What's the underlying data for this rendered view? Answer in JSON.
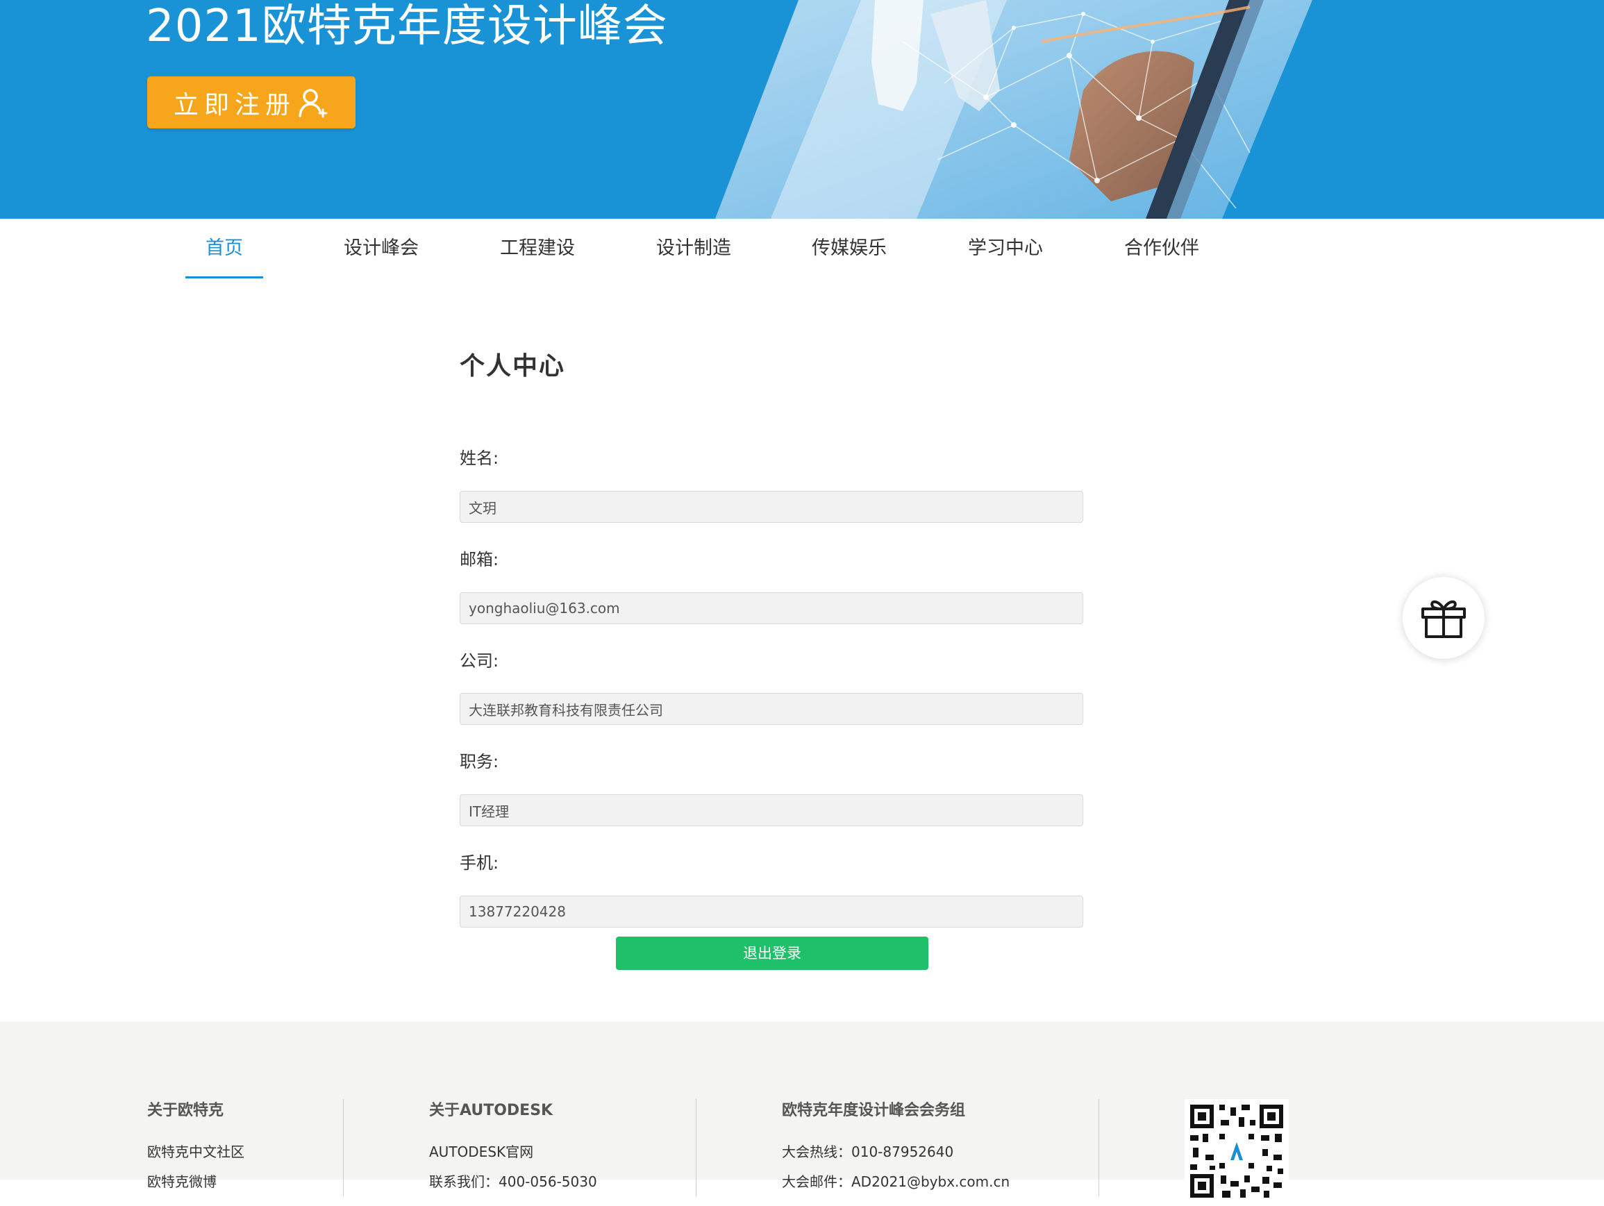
{
  "colors": {
    "brand_blue": "#1a93d6",
    "nav_active": "#1a8fd6",
    "register_orange": "#f7a51b",
    "logout_green": "#1ec16a",
    "footer_bg": "#f4f4f2"
  },
  "hero": {
    "title": "2021欧特克年度设计峰会",
    "register_label": "立即注册",
    "register_icon": "add-user-icon"
  },
  "nav": {
    "items": [
      {
        "label": "首页",
        "active": true
      },
      {
        "label": "设计峰会",
        "active": false
      },
      {
        "label": "工程建设",
        "active": false
      },
      {
        "label": "设计制造",
        "active": false
      },
      {
        "label": "传媒娱乐",
        "active": false
      },
      {
        "label": "学习中心",
        "active": false
      },
      {
        "label": "合作伙伴",
        "active": false
      }
    ]
  },
  "profile": {
    "title": "个人中心",
    "fields": [
      {
        "label": "姓名:",
        "value": "文玥"
      },
      {
        "label": "邮箱:",
        "value": "yonghaoliu@163.com"
      },
      {
        "label": "公司:",
        "value": "大连联邦教育科技有限责任公司"
      },
      {
        "label": "职务:",
        "value": "IT经理"
      },
      {
        "label": "手机:",
        "value": "13877220428"
      }
    ],
    "logout_label": "退出登录"
  },
  "gift": {
    "icon": "gift-icon"
  },
  "footer": {
    "col1": {
      "heading": "关于欧特克",
      "links": [
        "欧特克中文社区",
        "欧特克微博"
      ]
    },
    "col2": {
      "heading": "关于AUTODESK",
      "links": [
        "AUTODESK官网",
        "联系我们：400-056-5030"
      ]
    },
    "col3": {
      "heading": "欧特克年度设计峰会会务组",
      "hotline": "大会热线：010-87952640",
      "email": "大会邮件：AD2021@bybx.com.cn"
    },
    "qr_icon": "qr-code-icon"
  }
}
